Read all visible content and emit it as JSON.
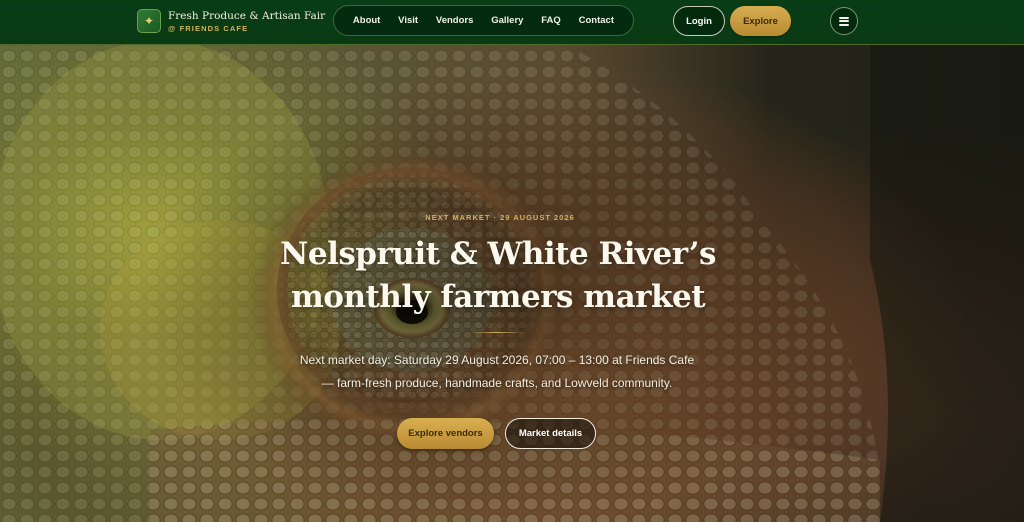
{
  "brand": {
    "title": "Fresh Produce & Artisan Fair",
    "subtitle": "@ FRIENDS CAFE",
    "logo_icon": "sparkle-icon"
  },
  "nav": {
    "links": [
      "About",
      "Visit",
      "Vendors",
      "Gallery",
      "FAQ",
      "Contact"
    ],
    "login_label": "Login",
    "explore_label": "Explore",
    "menu_icon": "hamburger-menu-icon"
  },
  "hero": {
    "eyebrow": "NEXT MARKET · 29 AUGUST 2026",
    "headline_line1": "Nelspruit & White River’s",
    "headline_line2": "monthly farmers market",
    "lead_line1": "Next market day: Saturday 29 August 2026, 07:00 – 13:00 at Friends Cafe",
    "lead_line2": "— farm-fresh produce, handmade crafts, and Lowveld community.",
    "primary_cta": "Explore vendors",
    "secondary_cta": "Market details",
    "background_subject": "chameleon-eye-photo"
  },
  "colors": {
    "header_bg": "#0a3a14",
    "accent_gold": "#c99a3e",
    "text_light": "#fbf8ee"
  }
}
